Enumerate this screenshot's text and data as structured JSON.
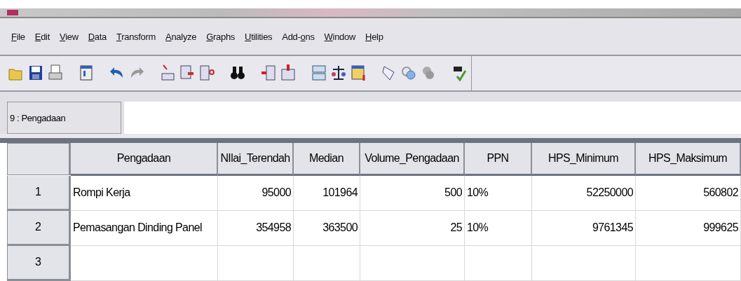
{
  "menu": [
    {
      "label": "File"
    },
    {
      "label": "Edit"
    },
    {
      "label": "View"
    },
    {
      "label": "Data"
    },
    {
      "label": "Transform"
    },
    {
      "label": "Analyze"
    },
    {
      "label": "Graphs"
    },
    {
      "label": "Utilities"
    },
    {
      "label": "Add-ons"
    },
    {
      "label": "Window"
    },
    {
      "label": "Help"
    }
  ],
  "cell_editor": {
    "label": "9 : Pengadaan"
  },
  "table": {
    "columns": [
      {
        "label": "Pengadaan",
        "kind": "string"
      },
      {
        "label": "NIlai_Terendah",
        "kind": "numeric"
      },
      {
        "label": "Median",
        "kind": "numeric"
      },
      {
        "label": "Volume_Pengadaan",
        "kind": "numeric"
      },
      {
        "label": "PPN",
        "kind": "string"
      },
      {
        "label": "HPS_Minimum",
        "kind": "numeric"
      },
      {
        "label": "HPS_Maksimum",
        "kind": "numeric"
      }
    ],
    "rows": [
      {
        "number": "1",
        "cells": [
          "Rompi Kerja",
          "95000",
          "101964",
          "500",
          "10%",
          "52250000",
          "560802"
        ]
      },
      {
        "number": "2",
        "cells": [
          "Pemasangan Dinding Panel",
          "354958",
          "363500",
          "25",
          "10%",
          "9761345",
          "999625"
        ]
      },
      {
        "number": "3",
        "cells": [
          "",
          "",
          "",
          "",
          "",
          "",
          ""
        ]
      }
    ]
  }
}
